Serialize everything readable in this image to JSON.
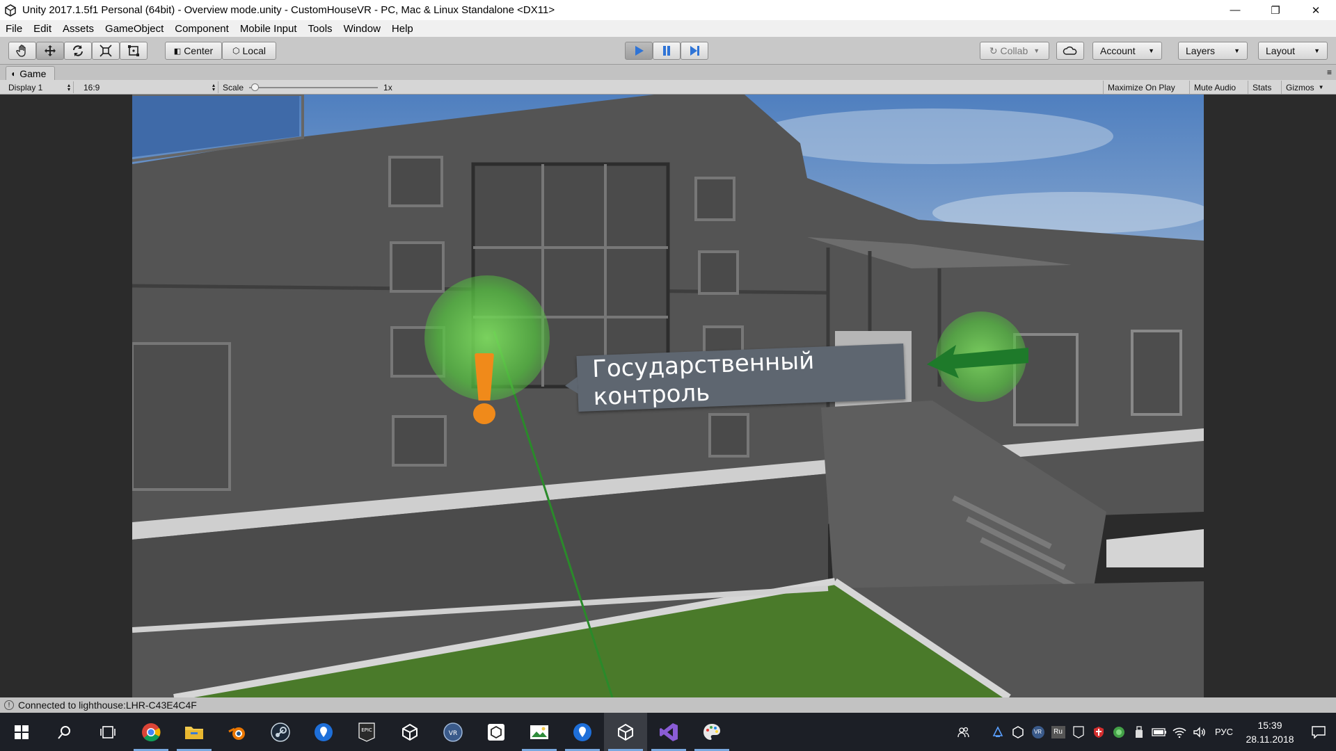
{
  "window": {
    "title": "Unity 2017.1.5f1 Personal (64bit) - Overview mode.unity - CustomHouseVR - PC, Mac & Linux Standalone <DX11>",
    "minimize": "—",
    "restore": "❐",
    "close": "✕"
  },
  "menu": [
    "File",
    "Edit",
    "Assets",
    "GameObject",
    "Component",
    "Mobile Input",
    "Tools",
    "Window",
    "Help"
  ],
  "toolbar": {
    "center": "Center",
    "local": "Local",
    "collab": "Collab",
    "account": "Account",
    "layers": "Layers",
    "layout": "Layout",
    "play_color": "#2f74d6"
  },
  "tab": {
    "label": "Game"
  },
  "gamebar": {
    "display": "Display 1",
    "aspect": "16:9",
    "scale_label": "Scale",
    "scale_value": "1x",
    "maximize": "Maximize On Play",
    "mute": "Mute Audio",
    "stats": "Stats",
    "gizmos": "Gizmos"
  },
  "scene": {
    "tooltip_text": "Государственный контроль",
    "marker_color": "#f08a1a",
    "highlight_color": "#55c040",
    "arrow_color": "#1e7a2a"
  },
  "status": {
    "text": "Connected to lighthouse:LHR-C43E4C4F"
  },
  "taskbar": {
    "lang": "РУС",
    "time": "15:39",
    "date": "28.11.2018",
    "vr": "VR",
    "ru": "Ru"
  }
}
